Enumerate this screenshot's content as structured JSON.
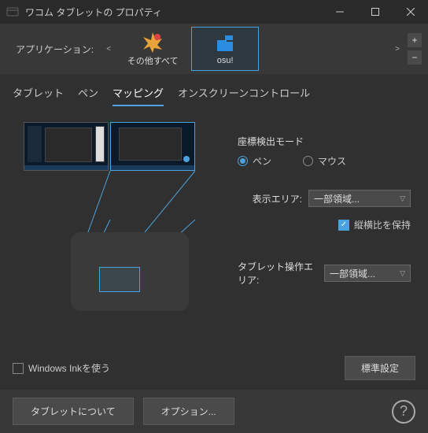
{
  "window": {
    "title": "ワコム タブレットの プロパティ"
  },
  "app_row": {
    "label": "アプリケーション:",
    "items": [
      {
        "label": "その他すべて",
        "selected": false
      },
      {
        "label": "osu!",
        "selected": true
      }
    ]
  },
  "tabs": [
    {
      "label": "タブレット",
      "active": false
    },
    {
      "label": "ペン",
      "active": false
    },
    {
      "label": "マッピング",
      "active": true
    },
    {
      "label": "オンスクリーンコントロール",
      "active": false
    }
  ],
  "mapping": {
    "mode_label": "座標検出モード",
    "mode_pen": "ペン",
    "mode_mouse": "マウス",
    "display_area_label": "表示エリア:",
    "display_area_value": "一部領域...",
    "aspect_label": "縦横比を保持",
    "tablet_area_label": "タブレット操作エリア:",
    "tablet_area_value": "一部領域...",
    "ink_label": "Windows Inkを使う",
    "default_btn": "標準設定"
  },
  "footer": {
    "about": "タブレットについて",
    "options": "オプション..."
  }
}
